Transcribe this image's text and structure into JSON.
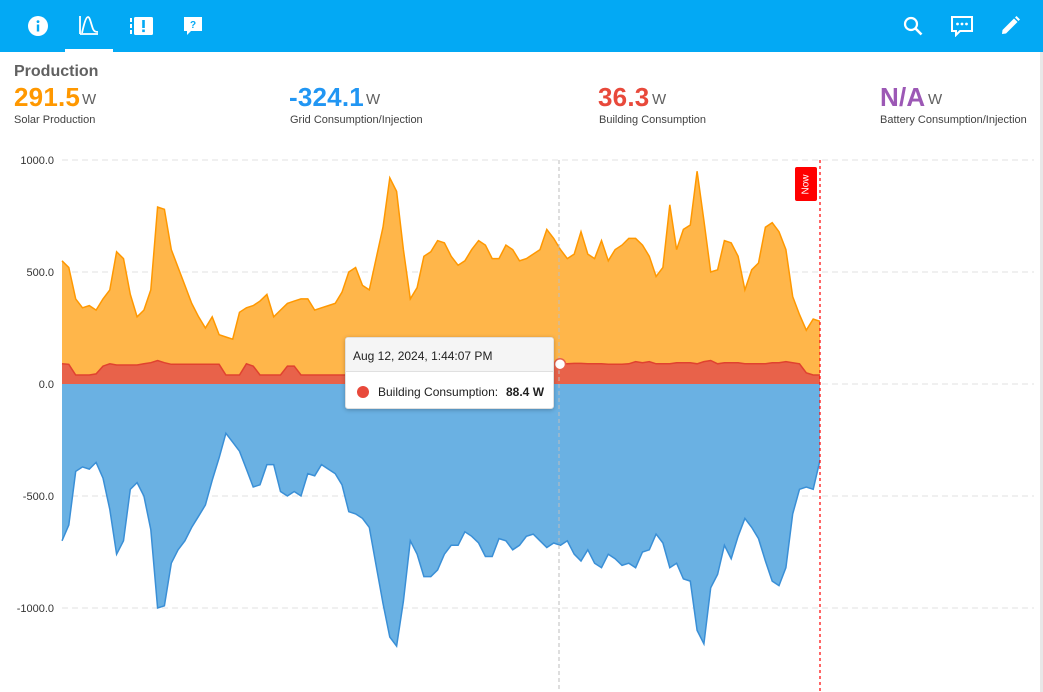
{
  "toolbar": {
    "icons": [
      "info-icon",
      "chart-icon",
      "alert-icon",
      "help-icon",
      "search-icon",
      "comment-icon",
      "pencil-icon"
    ],
    "active_tab": "chart-icon"
  },
  "section_title": "Production",
  "stats": [
    {
      "value": "291.5",
      "unit": "W",
      "label": "Solar Production",
      "color": "#ff9800"
    },
    {
      "value": "-324.1",
      "unit": "W",
      "label": "Grid Consumption/Injection",
      "color": "#2196f3"
    },
    {
      "value": "36.3",
      "unit": "W",
      "label": "Building Consumption",
      "color": "#e8493b"
    },
    {
      "value": "N/A",
      "unit": "W",
      "label": "Battery Consumption/Injection",
      "color": "#9c58b5"
    }
  ],
  "tooltip": {
    "date": "Aug 12, 2024, 1:44:07 PM",
    "series": "Building Consumption:",
    "value": "88.4 W"
  },
  "now_label": "Now",
  "chart_data": {
    "type": "area",
    "ylim": [
      -1000,
      1000
    ],
    "ytick_labels": [
      "1000.0",
      "500.0",
      "0.0",
      "-500.0",
      "-1000.0"
    ],
    "yticks": [
      1000,
      500,
      0,
      -500,
      -1000
    ],
    "grid": true,
    "colors": {
      "solar": "#ffb64a",
      "solar_line": "#ff9800",
      "building": "#e8624a",
      "building_line": "#e0422f",
      "grid": "#6ab1e3",
      "grid_line": "#3a8fd6"
    },
    "series": [
      {
        "name": "Solar Production",
        "values": [
          550,
          520,
          380,
          340,
          350,
          330,
          380,
          420,
          590,
          560,
          400,
          300,
          330,
          420,
          790,
          780,
          600,
          520,
          440,
          360,
          300,
          250,
          300,
          220,
          210,
          200,
          320,
          340,
          350,
          370,
          400,
          300,
          330,
          360,
          370,
          380,
          380,
          330,
          340,
          350,
          360,
          410,
          500,
          520,
          440,
          420,
          560,
          700,
          920,
          860,
          600,
          380,
          430,
          570,
          590,
          640,
          630,
          570,
          530,
          550,
          600,
          640,
          620,
          560,
          560,
          620,
          600,
          550,
          560,
          580,
          600,
          690,
          650,
          600,
          560,
          580,
          680,
          580,
          560,
          640,
          550,
          600,
          620,
          650,
          650,
          620,
          570,
          480,
          520,
          800,
          600,
          690,
          710,
          950,
          730,
          500,
          510,
          640,
          630,
          570,
          420,
          510,
          540,
          700,
          720,
          680,
          600,
          390,
          310,
          240,
          290,
          280
        ]
      },
      {
        "name": "Building Consumption",
        "values": [
          90,
          88,
          40,
          40,
          40,
          45,
          80,
          90,
          85,
          85,
          85,
          85,
          90,
          95,
          105,
          95,
          88,
          88,
          88,
          88,
          88,
          88,
          88,
          88,
          40,
          40,
          40,
          90,
          80,
          40,
          40,
          40,
          40,
          80,
          80,
          40,
          40,
          40,
          40,
          40,
          40,
          40,
          40,
          40,
          40,
          40,
          40,
          40,
          40,
          40,
          40,
          40,
          40,
          40,
          40,
          40,
          40,
          40,
          40,
          40,
          40,
          40,
          40,
          40,
          40,
          40,
          40,
          40,
          40,
          40,
          80,
          85,
          88,
          90,
          90,
          92,
          92,
          90,
          90,
          90,
          88,
          88,
          88,
          90,
          100,
          95,
          100,
          90,
          90,
          90,
          95,
          95,
          95,
          90,
          100,
          105,
          90,
          95,
          95,
          95,
          90,
          90,
          90,
          90,
          95,
          95,
          100,
          95,
          90,
          50,
          40,
          40
        ]
      },
      {
        "name": "Grid Consumption/Injection",
        "values": [
          -700,
          -630,
          -390,
          -370,
          -380,
          -350,
          -420,
          -560,
          -760,
          -700,
          -470,
          -440,
          -500,
          -650,
          -1000,
          -990,
          -800,
          -740,
          -700,
          -640,
          -590,
          -540,
          -430,
          -330,
          -220,
          -260,
          -300,
          -380,
          -460,
          -450,
          -360,
          -360,
          -480,
          -500,
          -480,
          -500,
          -400,
          -410,
          -360,
          -380,
          -400,
          -450,
          -570,
          -580,
          -600,
          -640,
          -810,
          -980,
          -1130,
          -1170,
          -970,
          -700,
          -760,
          -860,
          -860,
          -830,
          -760,
          -720,
          -720,
          -660,
          -680,
          -710,
          -770,
          -770,
          -690,
          -700,
          -740,
          -720,
          -680,
          -670,
          -700,
          -730,
          -710,
          -720,
          -700,
          -760,
          -790,
          -740,
          -800,
          -820,
          -760,
          -780,
          -810,
          -800,
          -820,
          -750,
          -740,
          -670,
          -710,
          -820,
          -800,
          -870,
          -880,
          -1100,
          -1160,
          -910,
          -850,
          -720,
          -780,
          -680,
          -600,
          -640,
          -690,
          -790,
          -880,
          -900,
          -820,
          -580,
          -470,
          -460,
          -470,
          -340
        ]
      }
    ]
  }
}
